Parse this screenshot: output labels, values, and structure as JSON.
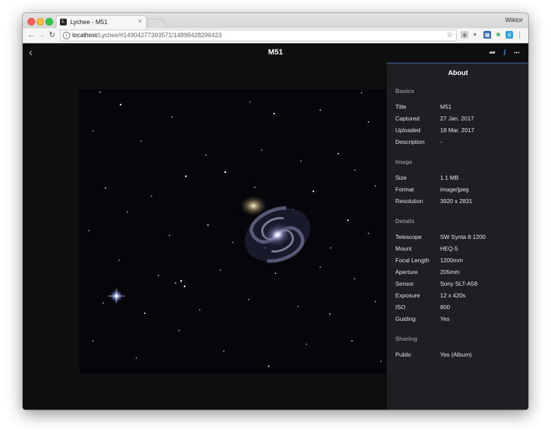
{
  "browser": {
    "tab_title": "Lychee - M51",
    "tab_favicon": "lychee-icon",
    "tab_close": "×",
    "profile_name": "Wiktor",
    "url_host": "localhost",
    "url_path": "/Lychee/#14904277393571/14898428296423"
  },
  "header": {
    "title": "M51",
    "back_icon": "‹",
    "share_icon": "➦",
    "info_icon": "i",
    "more_icon": "•••"
  },
  "sidebar": {
    "title": "About",
    "sections": [
      {
        "heading": "Basics",
        "rows": [
          {
            "label": "Title",
            "value": "M51"
          },
          {
            "label": "Captured",
            "value": "27 Jan. 2017"
          },
          {
            "label": "Uploaded",
            "value": "18 Mar. 2017"
          },
          {
            "label": "Description",
            "value": "-"
          }
        ]
      },
      {
        "heading": "Image",
        "rows": [
          {
            "label": "Size",
            "value": "1.1 MB"
          },
          {
            "label": "Format",
            "value": "image/jpeg"
          },
          {
            "label": "Resolution",
            "value": "3920 x 2831"
          }
        ]
      },
      {
        "heading": "Details",
        "rows": [
          {
            "label": "Telescope",
            "value": "SW Synta 8 1200"
          },
          {
            "label": "Mount",
            "value": "HEQ-5"
          },
          {
            "label": "Focal Length",
            "value": "1200mm"
          },
          {
            "label": "Aperture",
            "value": "205mm"
          },
          {
            "label": "Sensor",
            "value": "Sony SLT-A58"
          },
          {
            "label": "Exposure",
            "value": "12 x 420s"
          },
          {
            "label": "ISO",
            "value": "800"
          },
          {
            "label": "Guiding",
            "value": "Yes"
          }
        ]
      },
      {
        "heading": "Sharing",
        "rows": [
          {
            "label": "Public",
            "value": "Yes (Album)"
          }
        ]
      }
    ]
  },
  "colors": {
    "accent": "#3d6fb6",
    "sidebar_bg": "#1d1f22",
    "page_bg": "#0e0e10"
  }
}
